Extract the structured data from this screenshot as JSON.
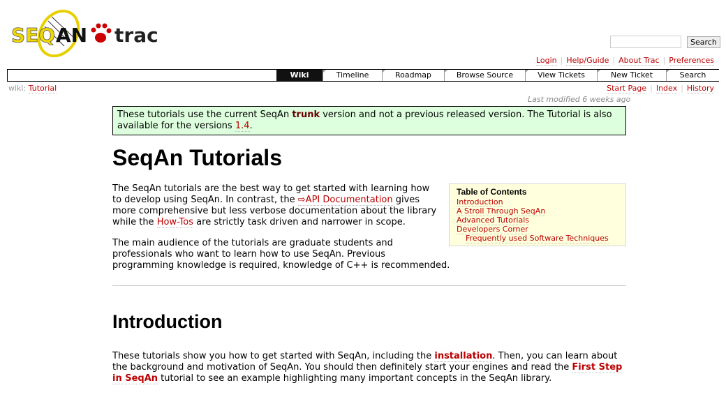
{
  "logo": {
    "text_left": "SEQAN",
    "text_right": "trac"
  },
  "search": {
    "button": "Search",
    "value": ""
  },
  "metanav": [
    "Login",
    "Help/Guide",
    "About Trac",
    "Preferences"
  ],
  "mainnav": [
    "Wiki",
    "Timeline",
    "Roadmap",
    "Browse Source",
    "View Tickets",
    "New Ticket",
    "Search"
  ],
  "breadcrumb": {
    "prefix": "wiki:",
    "page": "Tutorial"
  },
  "ctxnav": [
    "Start Page",
    "Index",
    "History"
  ],
  "last_modified": "Last modified 6 weeks ago",
  "notice": {
    "t1": "These tutorials use the current SeqAn ",
    "trunk": "trunk",
    "t2": " version and not a previous released version. The Tutorial is also available for the versions ",
    "ver": "1.4",
    "t3": "."
  },
  "title": "SeqAn Tutorials",
  "toc": {
    "title": "Table of Contents",
    "items": [
      "Introduction",
      "A Stroll Through SeqAn",
      "Advanced Tutorials",
      "Developers Corner",
      "Frequently used Software Techniques"
    ]
  },
  "p1": {
    "t1": "The SeqAn tutorials are the best way to get started with learning how to develop using SeqAn. In contrast, the ",
    "api": "⇨API Documentation",
    "t2": " gives more comprehensive but less verbose documentation about the library while the ",
    "howtos": "How-Tos",
    "t3": " are strictly task driven and narrower in scope."
  },
  "p2": "The main audience of the tutorials are graduate students and professionals who want to learn how to use SeqAn. Previous programming knowledge is required, knowledge of C++ is recommended.",
  "intro": {
    "heading": "Introduction",
    "t1": "These tutorials show you how to get started with SeqAn, including the ",
    "install": "installation",
    "t2": ". Then, you can learn about the background and motivation of SeqAn. You should then definitely start your engines and read the ",
    "first": "First Step in SeqAn",
    "t3": " tutorial to see an example highlighting many important concepts in the SeqAn library."
  }
}
